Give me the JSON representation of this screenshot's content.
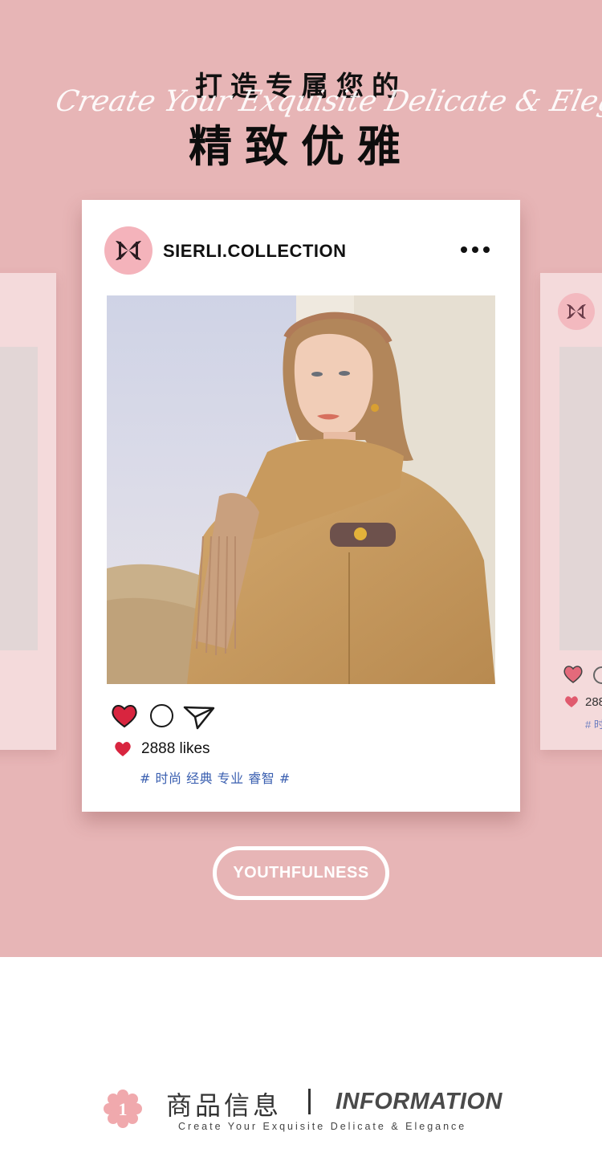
{
  "hero": {
    "title_top": "打造专属您的",
    "title_script": "Create Your Exquisite Delicate & Elegance",
    "title_main": "精致优雅"
  },
  "post": {
    "username": "SIERLI.COLLECTION",
    "likes_text": "2888 likes",
    "hashtags": "# 时尚 经典 专业 睿智 #",
    "photo_subject": "woman-in-camel-coat-and-scarf"
  },
  "side_card": {
    "likes_text": "288",
    "hashtags": "# 时"
  },
  "button": {
    "label": "YOUTHFULNESS"
  },
  "info": {
    "badge_number": "1",
    "title_cn": "商品信息",
    "title_en": "INFORMATION",
    "subtitle": "Create Your Exquisite Delicate & Elegance"
  },
  "colors": {
    "hero_bg": "#e7b5b6",
    "heart_red": "#d8253f",
    "hashtag_blue": "#3a5fb0",
    "avatar_pink": "#f4b3bb"
  },
  "icons": {
    "avatar": "brand-logo-icon",
    "more": "more-dots-icon",
    "like": "heart-icon",
    "comment": "comment-circle-icon",
    "share": "send-arrow-icon",
    "badge": "flower-badge-icon"
  }
}
